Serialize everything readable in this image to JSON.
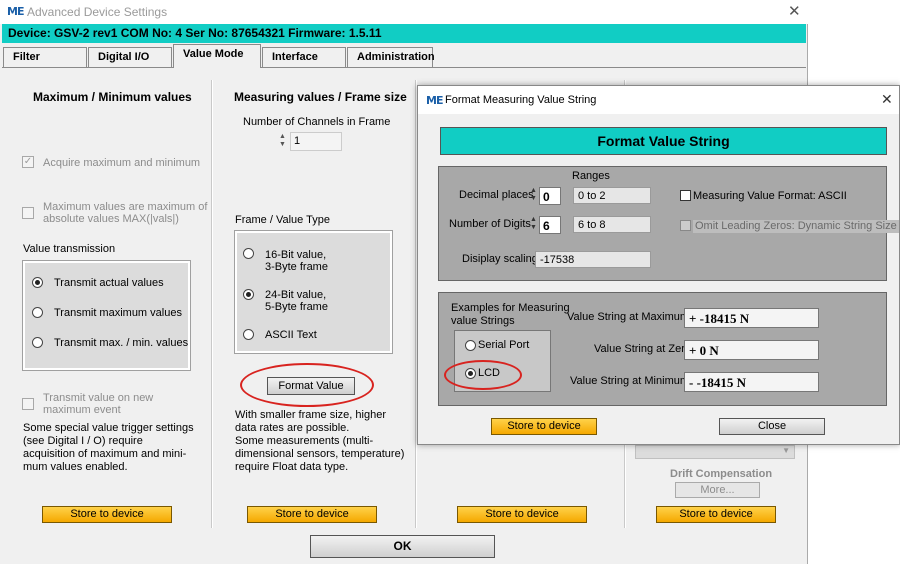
{
  "main_window": {
    "title": "Advanced Device Settings",
    "logo_text": "ME",
    "device_info": "Device: GSV-2 rev1 COM No: 4 Ser No: 87654321 Firmware: 1.5.11",
    "tabs": [
      {
        "label": "Filter",
        "active": false
      },
      {
        "label": "Digital I/O",
        "active": false
      },
      {
        "label": "Value Mode",
        "active": true
      },
      {
        "label": "Interface",
        "active": false
      },
      {
        "label": "Administration",
        "active": false
      }
    ],
    "ok_label": "OK"
  },
  "maxmin": {
    "heading": "Maximum / Minimum values",
    "acquire_label": "Acquire maximum and minimum",
    "acquire_checked": true,
    "absolute_label_1": "Maximum values are maximum of",
    "absolute_label_2": "absolute values MAX(|vals|)",
    "value_transmission_label": "Value transmission",
    "radios": [
      "Transmit actual values",
      "Transmit maximum values",
      "Transmit max. / min. values"
    ],
    "selected_radio": 0,
    "new_max_label_1": "Transmit value on new",
    "new_max_label_2": "maximum event",
    "note": [
      "Some special value trigger settings",
      "(see Digital I / O) require",
      "acquisition of maximum and mini-",
      "mum values enabled."
    ],
    "store_label": "Store to device"
  },
  "measuring": {
    "heading": "Measuring values / Frame size",
    "channels_label": "Number of Channels in Frame",
    "channels_value": "1",
    "frame_type_label": "Frame / Value Type",
    "opt1_line1": "16-Bit value,",
    "opt1_line2": "3-Byte frame",
    "opt2_line1": "24-Bit value,",
    "opt2_line2": "5-Byte frame",
    "opt3": "ASCII Text",
    "selected_frame": 1,
    "format_button": "Format Value",
    "note": [
      "With smaller frame size, higher",
      "data rates are possible.",
      "Some measurements (multi-",
      "dimensional sensors, temperature)",
      "require Float data type."
    ],
    "store_label": "Store to device"
  },
  "col3": {
    "store_label": "Store to device"
  },
  "col4": {
    "drift_label": "Drift Compensation",
    "more_label": "More...",
    "store_label": "Store to device"
  },
  "dialog": {
    "title": "Format Measuring Value String",
    "header": "Format Value String",
    "ranges_label": "Ranges",
    "decimal_label": "Decimal places",
    "decimal_value": "0",
    "decimal_range": "0 to 2",
    "digits_label": "Number of Digits",
    "digits_value": "6",
    "digits_range": "6 to 8",
    "scaling_label": "Disiplay scaling",
    "scaling_value": "-17538",
    "ascii_label": "Measuring Value Format: ASCII",
    "omit_label": "Omit Leading Zeros: Dynamic String Size",
    "examples_label_1": "Examples for Measuring",
    "examples_label_2": "value Strings",
    "serial_label": "Serial Port",
    "lcd_label": "LCD",
    "selected_example": "LCD",
    "max_label": "Value String at Maximum",
    "max_value": "+ -18415 N",
    "zero_label": "Value String at Zero",
    "zero_value": "+ 0 N",
    "min_label": "Value String at Minimum",
    "min_value": "- -18415 N",
    "store_label": "Store to device",
    "close_label": "Close"
  },
  "colors": {
    "accent_cyan": "#11cdc4",
    "button_orange": "#f5a800",
    "highlight_red": "#d8231f"
  },
  "icons": [
    "app-logo-icon",
    "close-icon",
    "spinner-icon",
    "checkbox-icon",
    "radio-icon"
  ]
}
